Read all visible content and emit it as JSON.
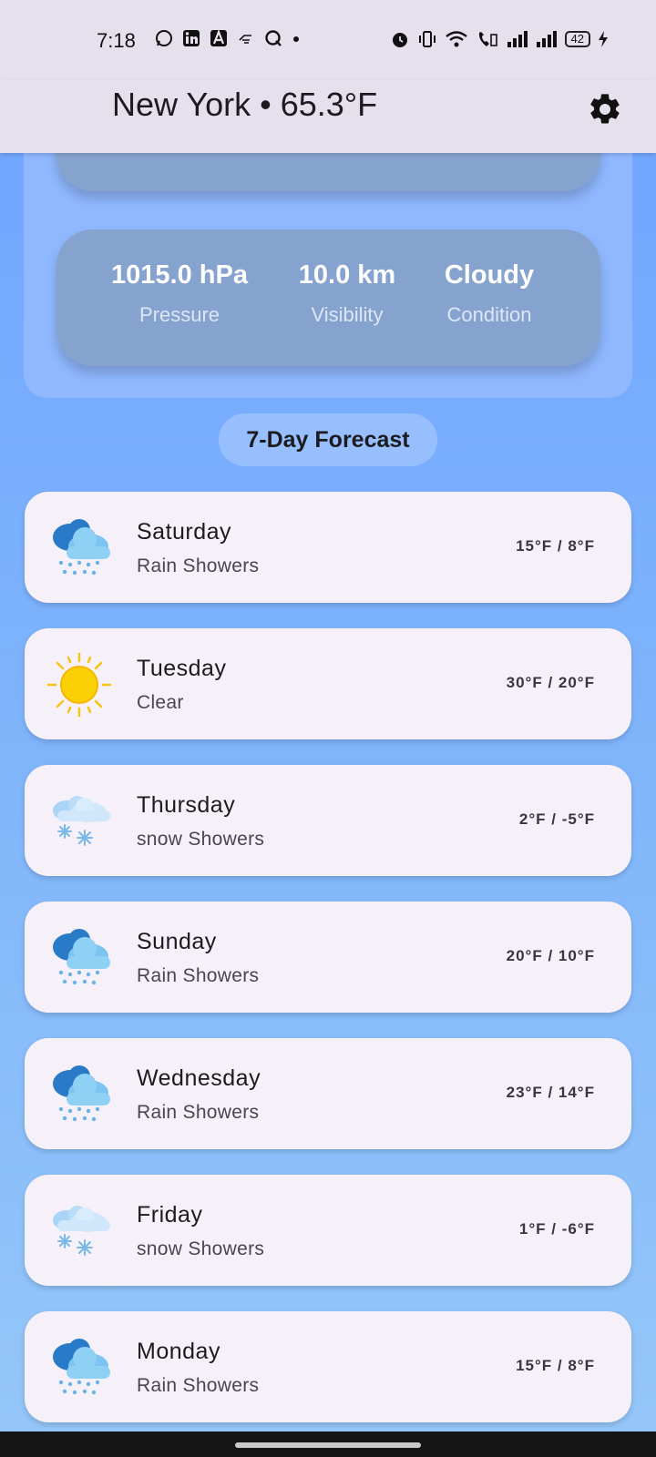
{
  "status": {
    "time": "7:18",
    "battery": "42",
    "left_icons": [
      "whatsapp-icon",
      "linkedin-icon",
      "a-app-icon",
      "hand-icon",
      "q-app-icon",
      "dot-icon"
    ],
    "right_icons": [
      "alarm-icon",
      "vibrate-icon",
      "wifi-icon",
      "call-icon",
      "signal-icon",
      "signal-icon",
      "charging-icon"
    ]
  },
  "header": {
    "title": "New York • 65.3°F",
    "settings_icon": "gear-icon"
  },
  "details": {
    "stats": [
      {
        "value": "1015.0 hPa",
        "label": "Pressure"
      },
      {
        "value": "10.0 km",
        "label": "Visibility"
      },
      {
        "value": "Cloudy",
        "label": "Condition"
      }
    ]
  },
  "forecast": {
    "heading": "7-Day Forecast",
    "days": [
      {
        "day": "Saturday",
        "condition": "Rain Showers",
        "temps": "15°F / 8°F",
        "icon": "rain-icon"
      },
      {
        "day": "Tuesday",
        "condition": "Clear",
        "temps": "30°F / 20°F",
        "icon": "sun-icon"
      },
      {
        "day": "Thursday",
        "condition": "snow Showers",
        "temps": "2°F / -5°F",
        "icon": "snow-icon"
      },
      {
        "day": "Sunday",
        "condition": "Rain Showers",
        "temps": "20°F / 10°F",
        "icon": "rain-icon"
      },
      {
        "day": "Wednesday",
        "condition": "Rain Showers",
        "temps": "23°F / 14°F",
        "icon": "rain-icon"
      },
      {
        "day": "Friday",
        "condition": "snow Showers",
        "temps": "1°F / -6°F",
        "icon": "snow-icon"
      },
      {
        "day": "Monday",
        "condition": "Rain Showers",
        "temps": "15°F / 8°F",
        "icon": "rain-icon"
      }
    ]
  },
  "colors": {
    "background_top": "#6fa3ff",
    "panel": "#8fb8fe",
    "stat_card": "#86a3cf",
    "day_card": "#f6f0f8",
    "app_bar": "#e6e0ec"
  }
}
